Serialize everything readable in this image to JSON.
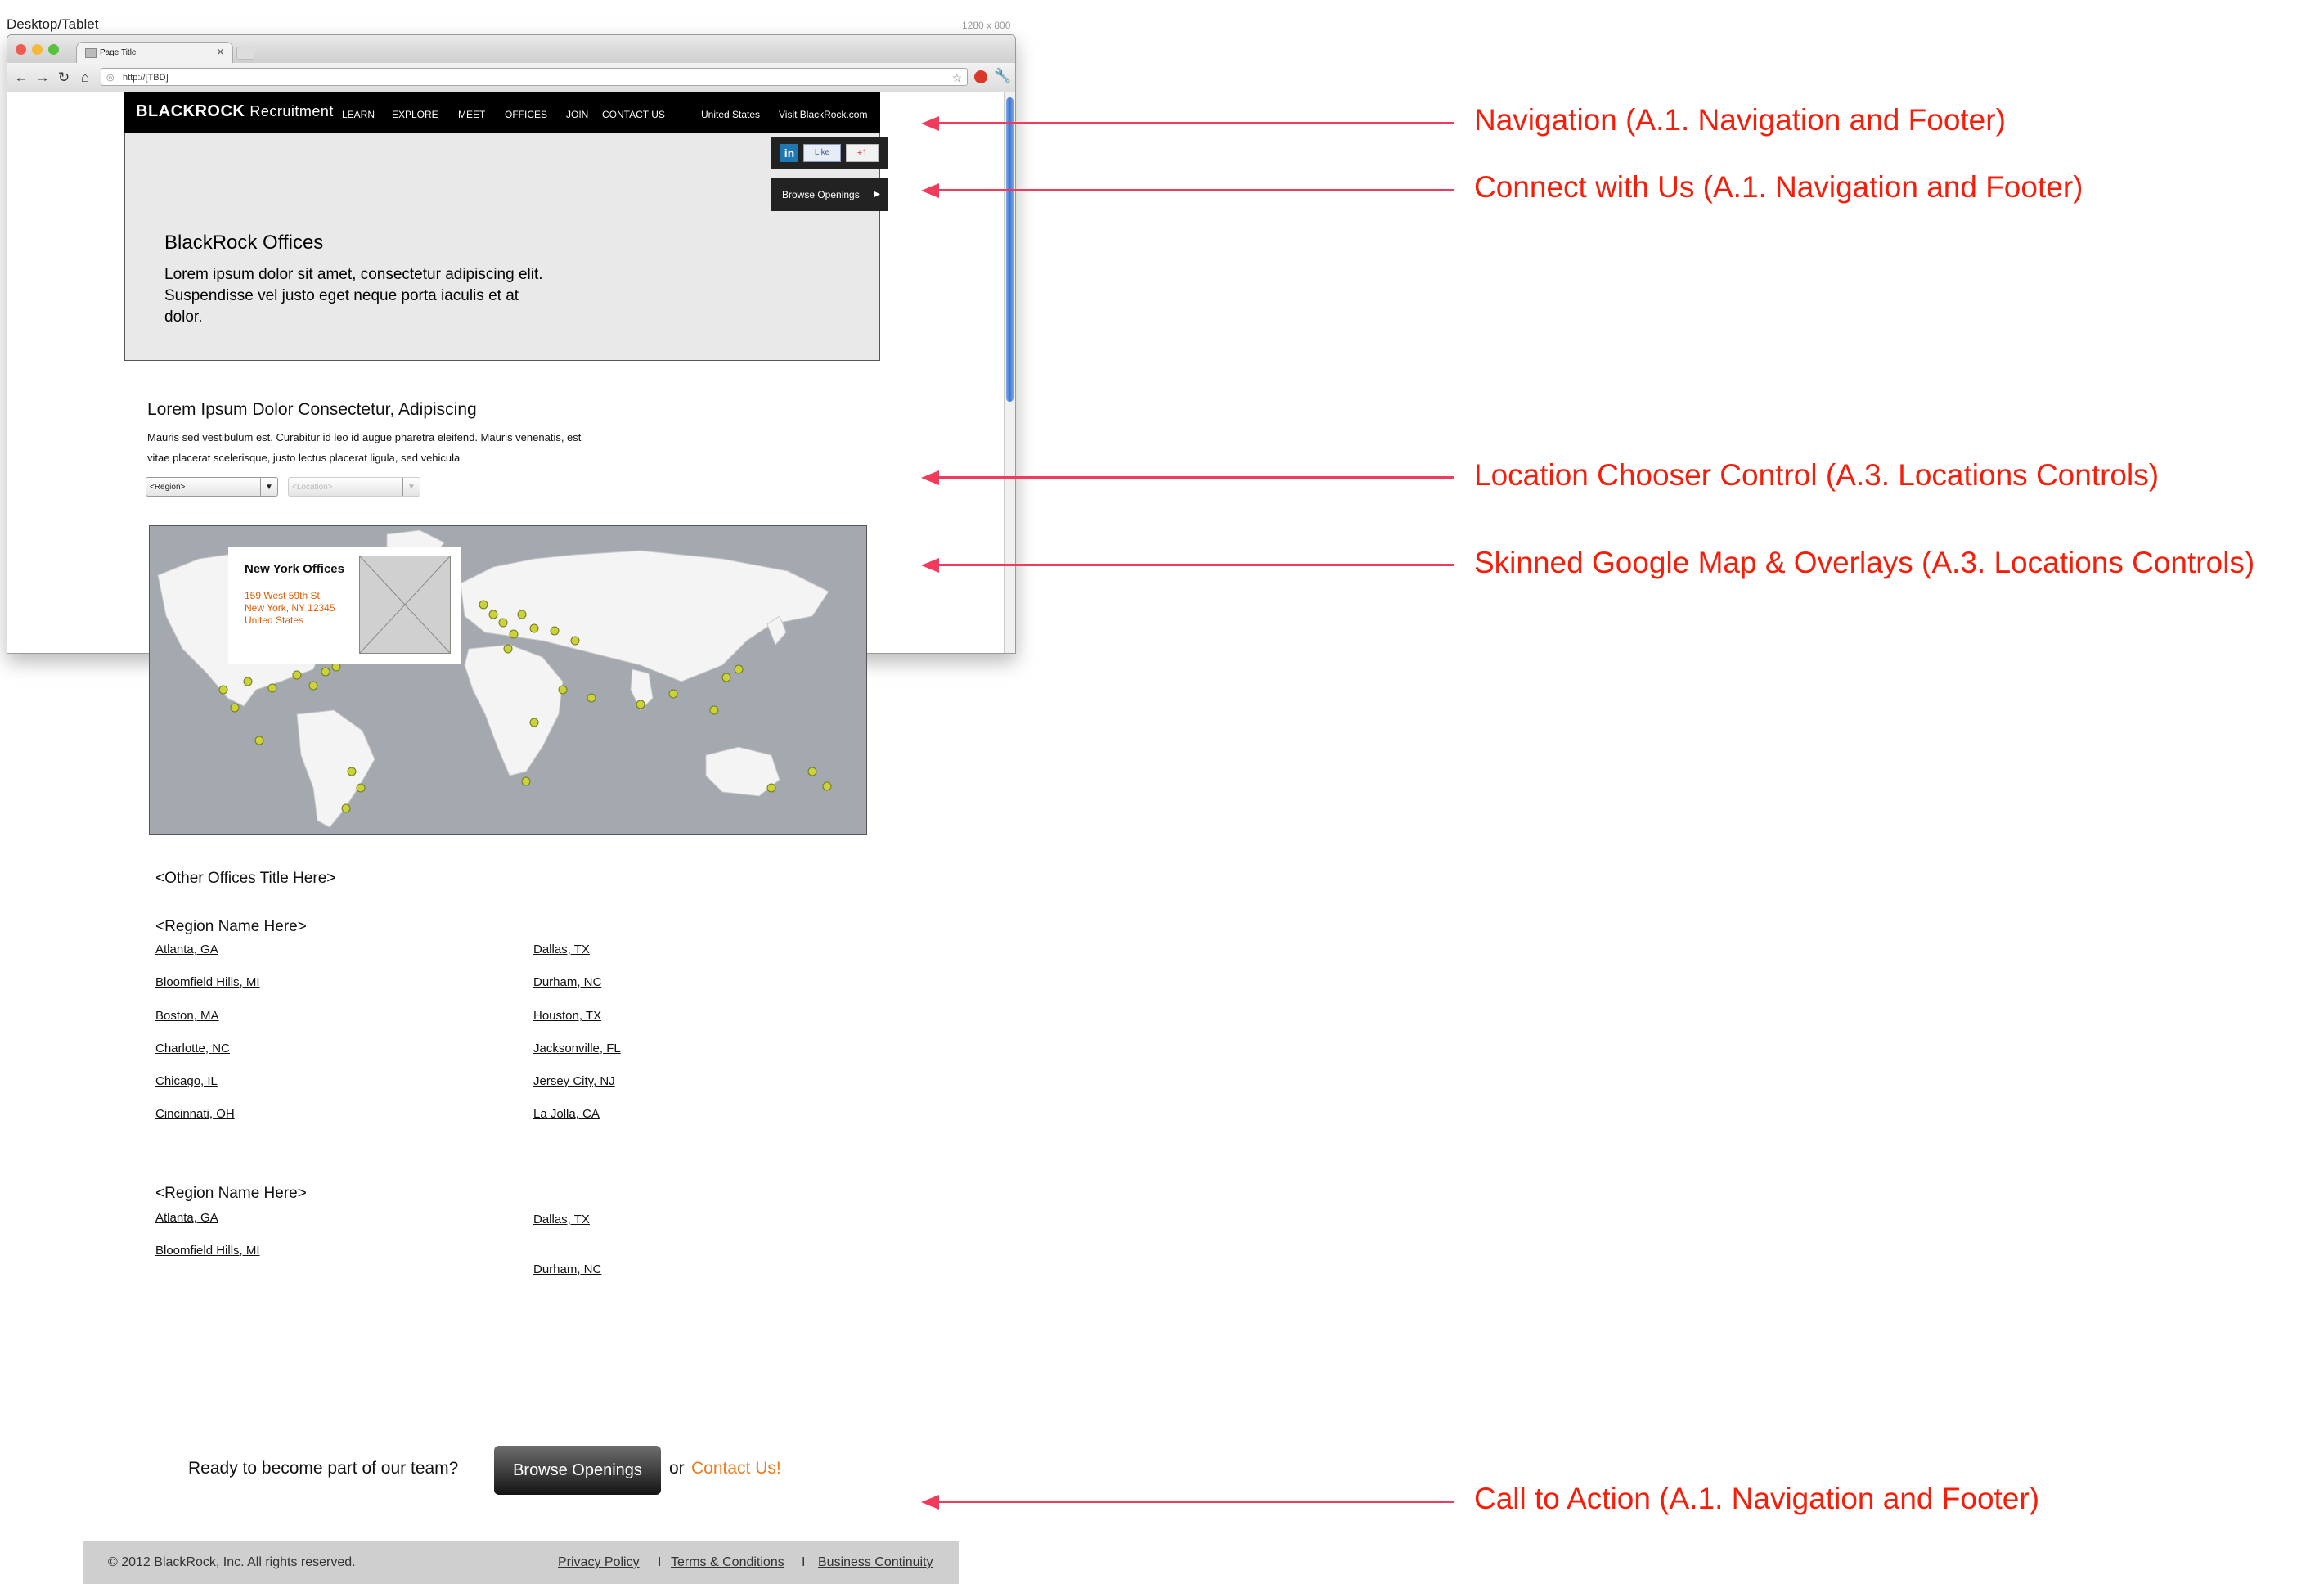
{
  "frame": {
    "label": "Desktop/Tablet",
    "resolution": "1280 x 800"
  },
  "browser": {
    "tab_title": "Page Title",
    "url": "http://[TBD]"
  },
  "site": {
    "brand": "BLACKROCK",
    "brand_suffix": "Recruitment",
    "nav": [
      "LEARN",
      "EXPLORE",
      "MEET",
      "OFFICES",
      "JOIN",
      "CONTACT US"
    ],
    "country": "United States",
    "visit_link": "Visit BlackRock.com",
    "social": {
      "linkedin": "in",
      "like": "Like",
      "plusone": "+1"
    },
    "browse_tab": "Browse Openings"
  },
  "hero": {
    "title": "BlackRock Offices",
    "text": "Lorem ipsum dolor sit amet, consectetur adipiscing elit. Suspendisse vel justo eget neque porta iaculis et at dolor."
  },
  "intro": {
    "title": "Lorem Ipsum Dolor Consectetur, Adipiscing",
    "text": "Mauris sed vestibulum est. Curabitur id leo id augue pharetra eleifend. Mauris venenatis, est vitae placerat scelerisque, justo lectus placerat ligula, sed vehicula"
  },
  "chooser": {
    "region": "<Region>",
    "location": "<Location>"
  },
  "map": {
    "info_title": "New York Offices",
    "info_address": [
      "159 West 59th St.",
      "New York, NY 12345",
      "United States"
    ]
  },
  "other_offices": {
    "title": "<Other Offices Title Here>",
    "regions": [
      {
        "name": "<Region Name Here>",
        "left": [
          "Atlanta, GA",
          "Bloomfield Hills, MI",
          "Boston, MA",
          "Charlotte, NC",
          "Chicago, IL",
          "Cincinnati, OH"
        ],
        "right": [
          "Dallas, TX",
          "Durham, NC",
          "Houston, TX",
          "Jacksonville, FL",
          "Jersey City, NJ",
          "La Jolla, CA"
        ]
      },
      {
        "name": "<Region Name Here>",
        "left": [
          "Atlanta, GA",
          "Bloomfield Hills, MI"
        ],
        "right": [
          "Dallas, TX",
          "Durham, NC"
        ]
      }
    ]
  },
  "cta": {
    "question": "Ready to become part of our team?",
    "button": "Browse Openings",
    "or": "or",
    "contact": "Contact Us!"
  },
  "footer": {
    "copyright": "© 2012 BlackRock, Inc. All rights reserved.",
    "links": [
      "Privacy Policy",
      "Terms & Conditions",
      "Business Continuity"
    ],
    "separator": "I"
  },
  "annotations": [
    "Navigation (A.1. Navigation and Footer)",
    "Connect with Us (A.1. Navigation and Footer)",
    "Location Chooser Control (A.3. Locations Controls)",
    "Skinned Google Map & Overlays (A.3. Locations Controls)",
    "Call to Action (A.1. Navigation and Footer)"
  ],
  "colors": {
    "annotation": "#f51e0a",
    "arrow": "#f23b5c",
    "accent": "#f07a1a",
    "address": "#e55a00"
  }
}
